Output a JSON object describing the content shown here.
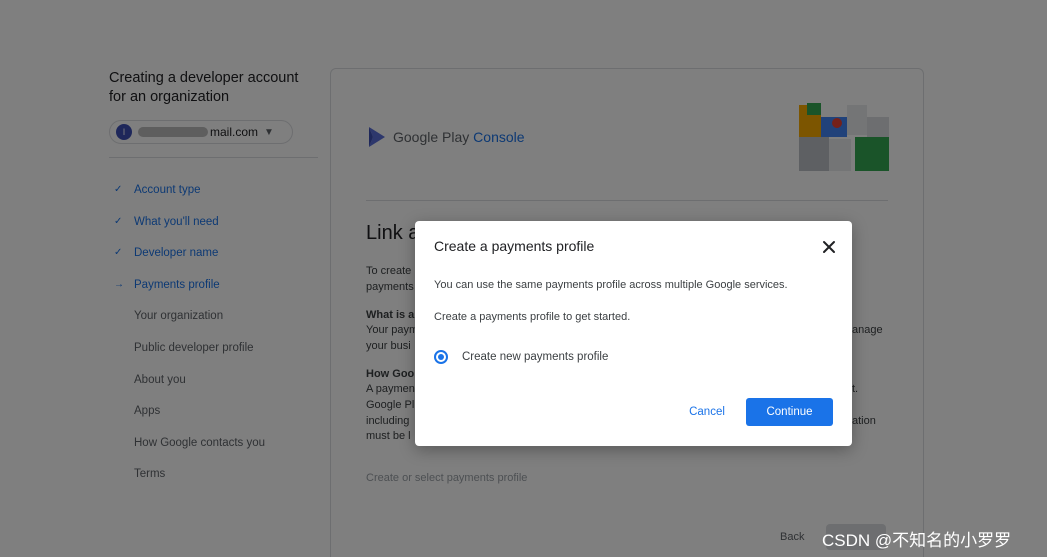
{
  "left_panel": {
    "title": "Creating a developer account for an organization",
    "account_email": "mail.com",
    "avatar_initial": "I",
    "steps": [
      {
        "label": "Account type",
        "state": "done"
      },
      {
        "label": "What you'll need",
        "state": "done"
      },
      {
        "label": "Developer name",
        "state": "done"
      },
      {
        "label": "Payments profile",
        "state": "current"
      },
      {
        "label": "Your organization",
        "state": "pending"
      },
      {
        "label": "Public developer profile",
        "state": "pending"
      },
      {
        "label": "About you",
        "state": "pending"
      },
      {
        "label": "Apps",
        "state": "pending"
      },
      {
        "label": "How Google contacts you",
        "state": "pending"
      },
      {
        "label": "Terms",
        "state": "pending"
      }
    ],
    "check_glyph": "✓",
    "arrow_glyph": "→"
  },
  "main": {
    "logo_word1": "Google Play",
    "logo_word2": "Console",
    "heading_visible": "Link a",
    "lines": [
      "To create",
      "payments",
      "What is a",
      "Your paym",
      "your busi",
      "How Goo",
      "A paymen",
      "Google Pl",
      "including",
      "must be l"
    ],
    "right_fragments": [
      "anage",
      "t.",
      "ation"
    ],
    "muted_link": "Create or select payments profile",
    "back_label": "Back"
  },
  "dialog": {
    "title": "Create a payments profile",
    "text1": "You can use the same payments profile across multiple Google services.",
    "text2": "Create a payments profile to get started.",
    "option_label": "Create new payments profile",
    "option_selected": true,
    "cancel_label": "Cancel",
    "continue_label": "Continue"
  },
  "watermark": "CSDN @不知名的小罗罗",
  "colors": {
    "accent": "#1a73e8",
    "scrim": "rgba(0,0,0,0.5)"
  }
}
